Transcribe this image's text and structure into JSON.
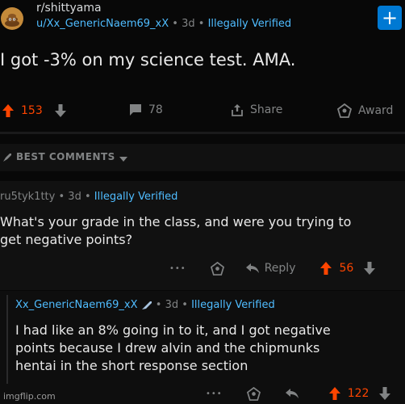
{
  "post": {
    "subreddit": "r/shittyama",
    "author": "u/Xx_GenericNaem69_xX",
    "age": "3d",
    "flair": "Illegally Verified",
    "title": "I got -3% on my science test. AMA.",
    "upvotes": "153",
    "comments": "78",
    "share_label": "Share",
    "award_label": "Award"
  },
  "sort": {
    "label": "BEST COMMENTS"
  },
  "comments": [
    {
      "author": "ru5tyk1tty",
      "age": "3d",
      "flair": "Illegally Verified",
      "body_lines": [
        "What's your grade in the class, and were you trying to",
        "get negative points?"
      ],
      "reply_label": "Reply",
      "score": "56"
    },
    {
      "author": "Xx_GenericNaem69_xX",
      "age": "3d",
      "flair": "Illegally Verified",
      "body_lines": [
        "I had like an 8% going in to it, and I got negative",
        "points because I drew alvin and the chipmunks",
        "hentai in the short response section"
      ],
      "score": "122"
    }
  ],
  "watermark": "imgflip.com",
  "glyphs": {
    "separator": "•",
    "more": "•••",
    "plus": "+"
  },
  "colors": {
    "upvote": "#ff4500",
    "link": "#4fbcff",
    "muted": "#818384",
    "join": "#0079d3"
  }
}
